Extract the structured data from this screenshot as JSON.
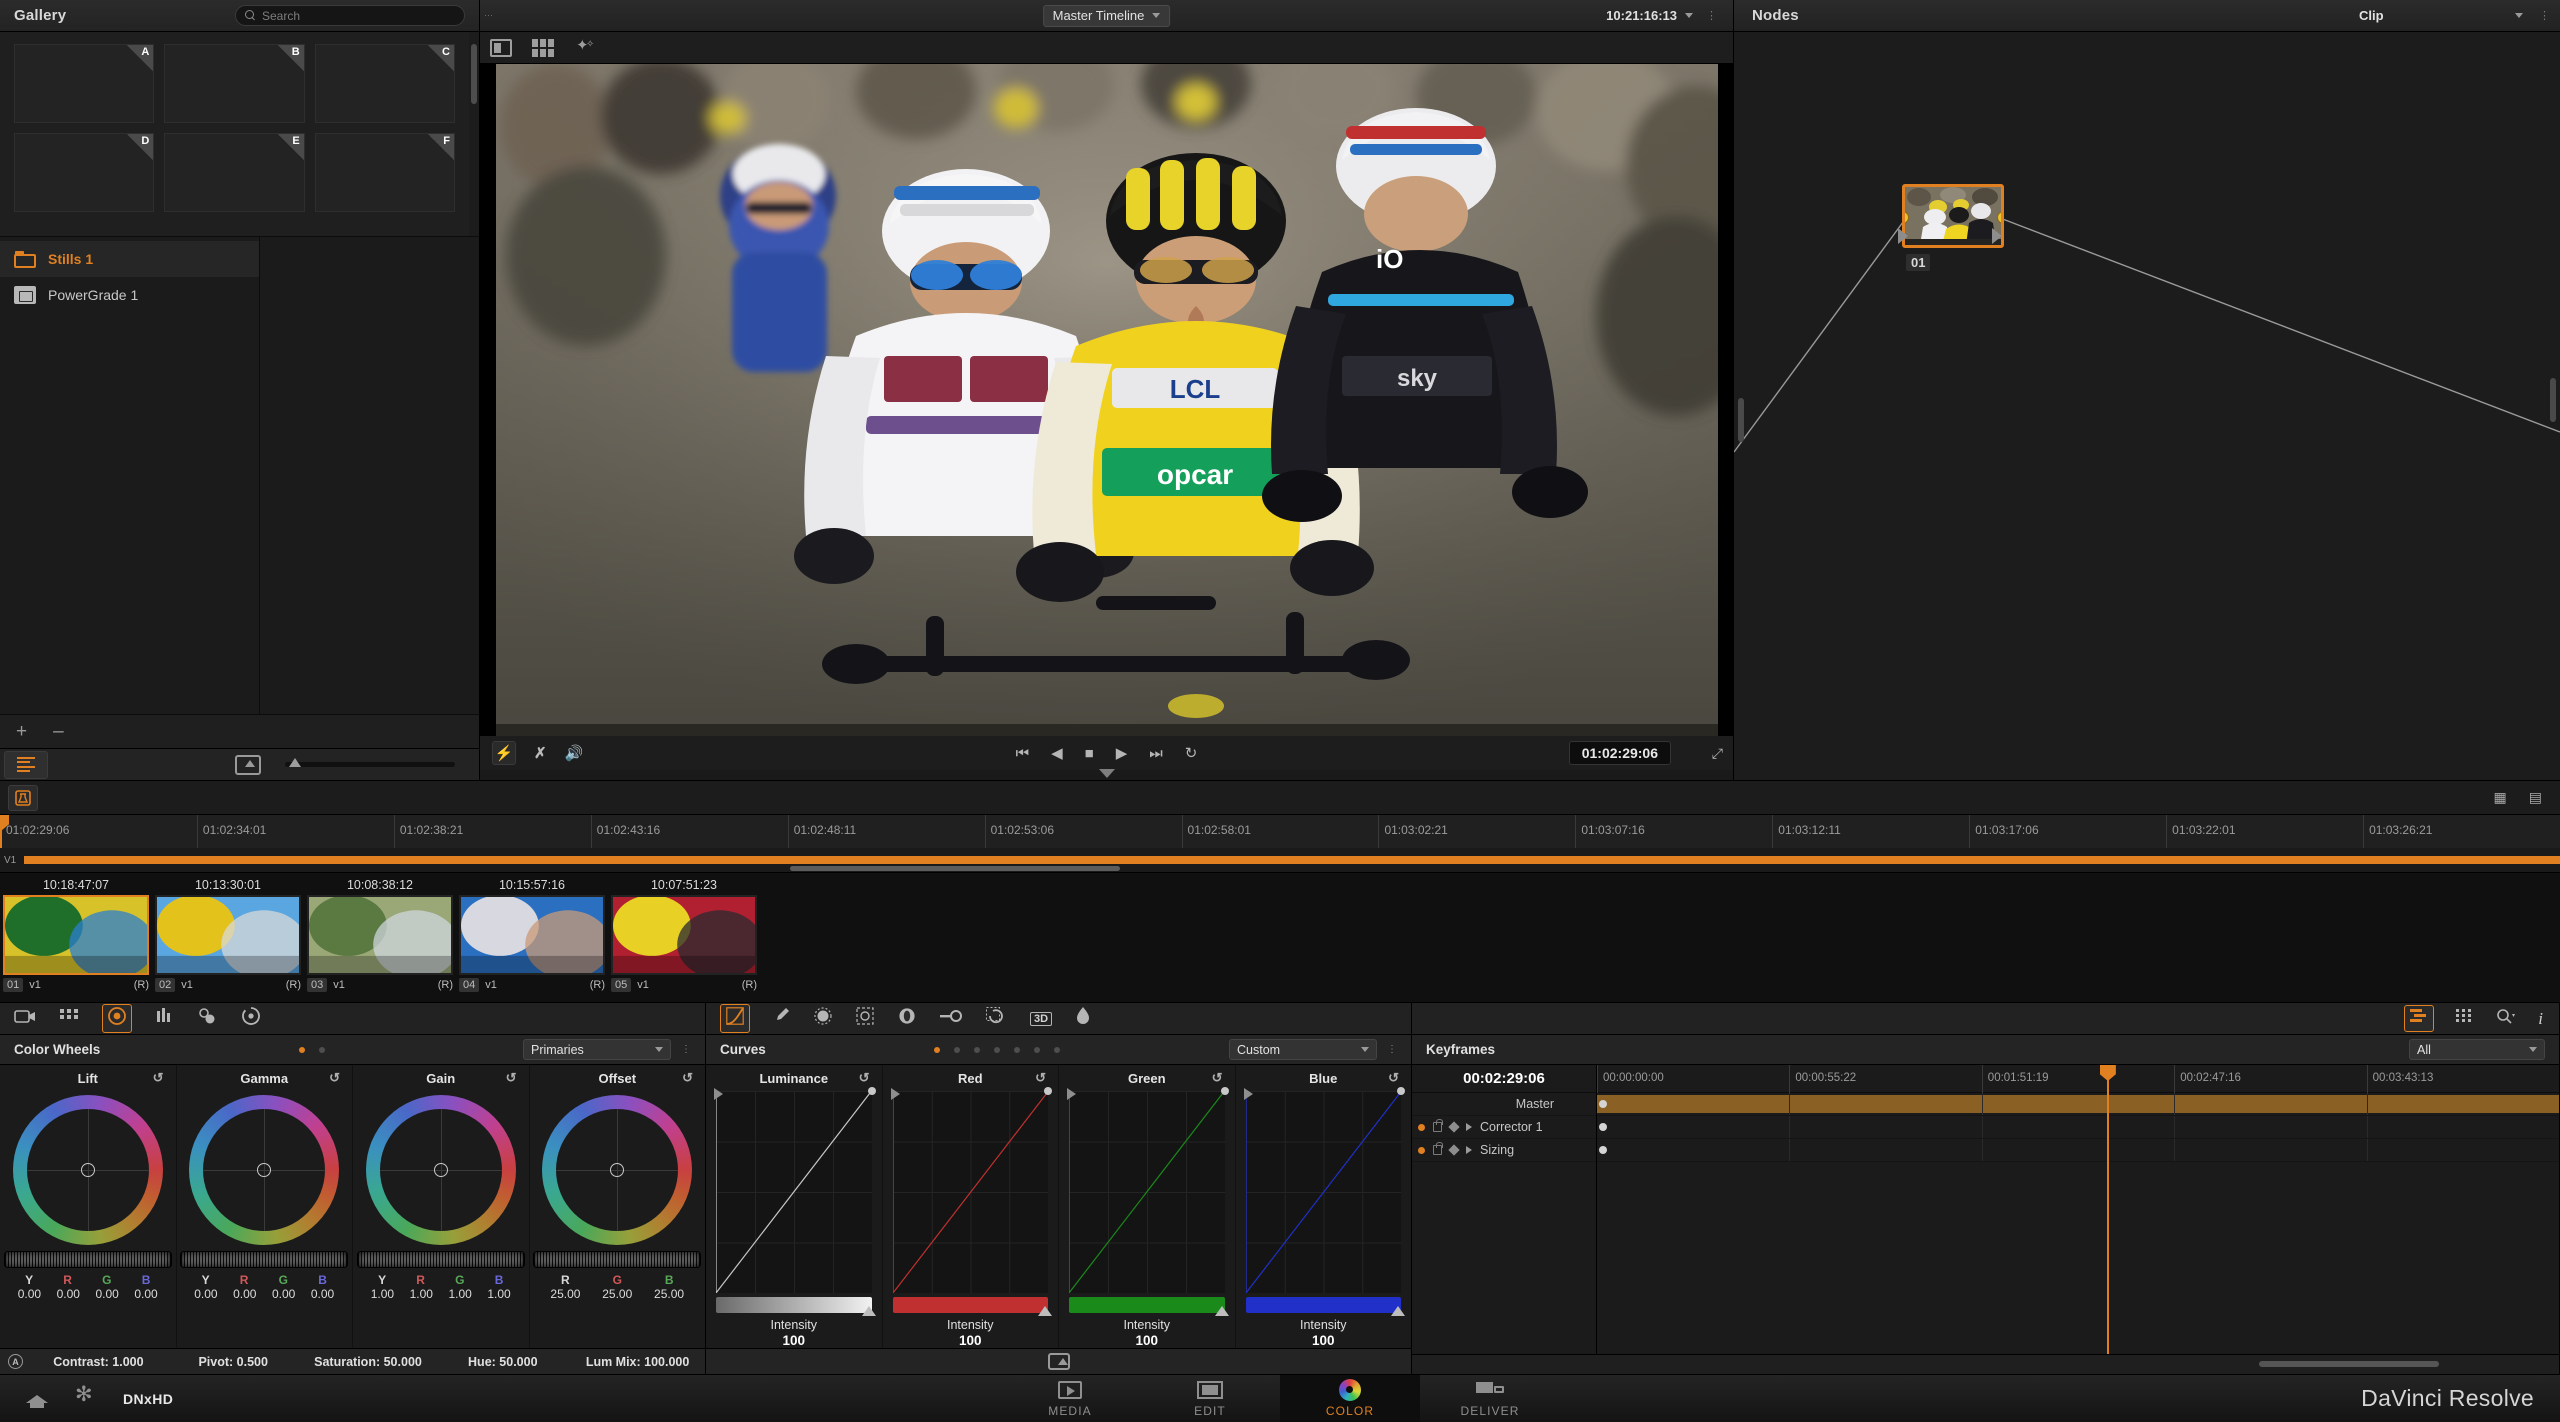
{
  "app": {
    "brand": "DaVinci Resolve",
    "codec": "DNxHD"
  },
  "gallery": {
    "title": "Gallery",
    "search_placeholder": "Search",
    "stills": [
      "A",
      "B",
      "C",
      "D",
      "E",
      "F"
    ],
    "albums": [
      {
        "label": "Stills 1",
        "icon": "folder-icon",
        "selected": true
      },
      {
        "label": "PowerGrade 1",
        "icon": "powergrade-icon",
        "selected": false
      }
    ],
    "add_label": "+",
    "remove_label": "–"
  },
  "viewer": {
    "timeline_label": "Master Timeline",
    "source_timecode": "10:21:16:13",
    "current_timecode": "01:02:29:06",
    "transport": {
      "first": "⏮",
      "reverse": "◀",
      "stop": "■",
      "play": "▶",
      "last": "⏭",
      "loop": "↻"
    }
  },
  "nodes": {
    "title": "Nodes",
    "scope_label": "Clip",
    "node_label": "01"
  },
  "timeline": {
    "ruler": [
      "01:02:29:06",
      "01:02:34:01",
      "01:02:38:21",
      "01:02:43:16",
      "01:02:48:11",
      "01:02:53:06",
      "01:02:58:01",
      "01:03:02:21",
      "01:03:07:16",
      "01:03:12:11",
      "01:03:17:06",
      "01:03:22:01",
      "01:03:26:21"
    ],
    "track_label": "V1",
    "clips": [
      {
        "timecode": "10:18:47:07",
        "num": "01",
        "track": "v1",
        "flag": "(R)",
        "selected": true
      },
      {
        "timecode": "10:13:30:01",
        "num": "02",
        "track": "v1",
        "flag": "(R)",
        "selected": false
      },
      {
        "timecode": "10:08:38:12",
        "num": "03",
        "track": "v1",
        "flag": "(R)",
        "selected": false
      },
      {
        "timecode": "10:15:57:16",
        "num": "04",
        "track": "v1",
        "flag": "(R)",
        "selected": false
      },
      {
        "timecode": "10:07:51:23",
        "num": "05",
        "track": "v1",
        "flag": "(R)",
        "selected": false
      }
    ]
  },
  "color_wheels": {
    "title": "Color Wheels",
    "mode": "Primaries",
    "wheels": [
      {
        "name": "Lift",
        "keys": [
          "Y",
          "R",
          "G",
          "B"
        ],
        "values": [
          "0.00",
          "0.00",
          "0.00",
          "0.00"
        ]
      },
      {
        "name": "Gamma",
        "keys": [
          "Y",
          "R",
          "G",
          "B"
        ],
        "values": [
          "0.00",
          "0.00",
          "0.00",
          "0.00"
        ]
      },
      {
        "name": "Gain",
        "keys": [
          "Y",
          "R",
          "G",
          "B"
        ],
        "values": [
          "1.00",
          "1.00",
          "1.00",
          "1.00"
        ]
      },
      {
        "name": "Offset",
        "keys": [
          "R",
          "G",
          "B"
        ],
        "values": [
          "25.00",
          "25.00",
          "25.00"
        ]
      }
    ],
    "footer": [
      {
        "label": "Contrast:",
        "value": "1.000"
      },
      {
        "label": "Pivot:",
        "value": "0.500"
      },
      {
        "label": "Saturation:",
        "value": "50.000"
      },
      {
        "label": "Hue:",
        "value": "50.000"
      },
      {
        "label": "Lum Mix:",
        "value": "100.000"
      }
    ],
    "auto_badge": "A",
    "reset_glyph": "↺"
  },
  "curves": {
    "title": "Curves",
    "mode": "Custom",
    "channels": [
      {
        "name": "Luminance",
        "intensity_label": "Intensity",
        "intensity": "100",
        "color": "#c8c8c8"
      },
      {
        "name": "Red",
        "intensity_label": "Intensity",
        "intensity": "100",
        "color": "#c03030"
      },
      {
        "name": "Green",
        "intensity_label": "Intensity",
        "intensity": "100",
        "color": "#1a8a1a"
      },
      {
        "name": "Blue",
        "intensity_label": "Intensity",
        "intensity": "100",
        "color": "#2030c8"
      }
    ],
    "reset_glyph": "↺"
  },
  "keyframes": {
    "title": "Keyframes",
    "filter": "All",
    "current_timecode": "00:02:29:06",
    "ruler": [
      "00:00:00:00",
      "00:00:55:22",
      "00:01:51:19",
      "00:02:47:16",
      "00:03:43:13"
    ],
    "tracks": [
      {
        "label": "Master",
        "master": true
      },
      {
        "label": "Corrector 1",
        "master": false
      },
      {
        "label": "Sizing",
        "master": false
      }
    ]
  },
  "pages": [
    {
      "label": "MEDIA",
      "icon": "media-icon",
      "active": false
    },
    {
      "label": "EDIT",
      "icon": "edit-icon",
      "active": false
    },
    {
      "label": "COLOR",
      "icon": "color-icon",
      "active": true
    },
    {
      "label": "DELIVER",
      "icon": "deliver-icon",
      "active": false
    }
  ],
  "colors": {
    "accent": "#e08020",
    "panel": "#1b1b1b",
    "bg": "#141414"
  }
}
